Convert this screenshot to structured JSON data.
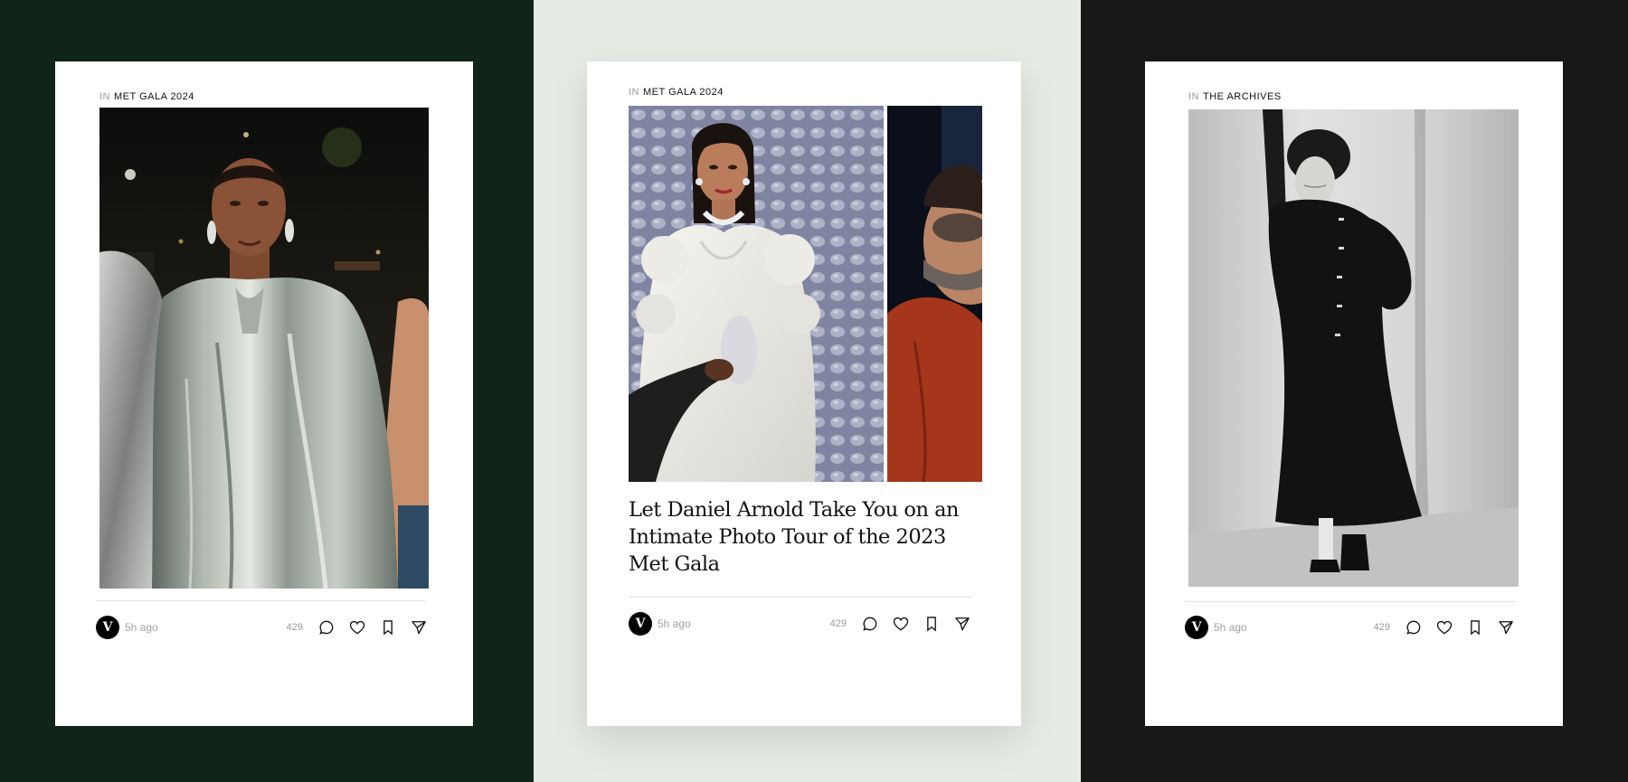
{
  "colors": {
    "panel_left_bg": "#0f2519",
    "panel_center_bg": "#e6ebe3",
    "panel_right_bg": "#181818",
    "card_bg": "#ffffff",
    "logo_bg": "#000000"
  },
  "cards": [
    {
      "kicker_prefix": "IN",
      "section": "MET GALA 2024",
      "photo": "serena-silver-cape-photo",
      "logo_letter": "V",
      "time": "5h ago",
      "comments": "429",
      "icons": [
        "comment-icon",
        "heart-icon",
        "bookmark-icon",
        "share-icon"
      ]
    },
    {
      "kicker_prefix": "IN",
      "section": "MET GALA 2024",
      "photo": "rihanna-white-gown-photo",
      "headline": "Let Daniel Arnold Take You on an Intimate Photo Tour of the 2023 Met Gala",
      "logo_letter": "V",
      "time": "5h ago",
      "comments": "429",
      "icons": [
        "comment-icon",
        "heart-icon",
        "bookmark-icon",
        "share-icon"
      ]
    },
    {
      "kicker_prefix": "IN",
      "section": "THE ARCHIVES",
      "photo": "archive-black-coat-photo",
      "logo_letter": "V",
      "time": "5h ago",
      "comments": "429",
      "icons": [
        "comment-icon",
        "heart-icon",
        "bookmark-icon",
        "share-icon"
      ]
    }
  ]
}
